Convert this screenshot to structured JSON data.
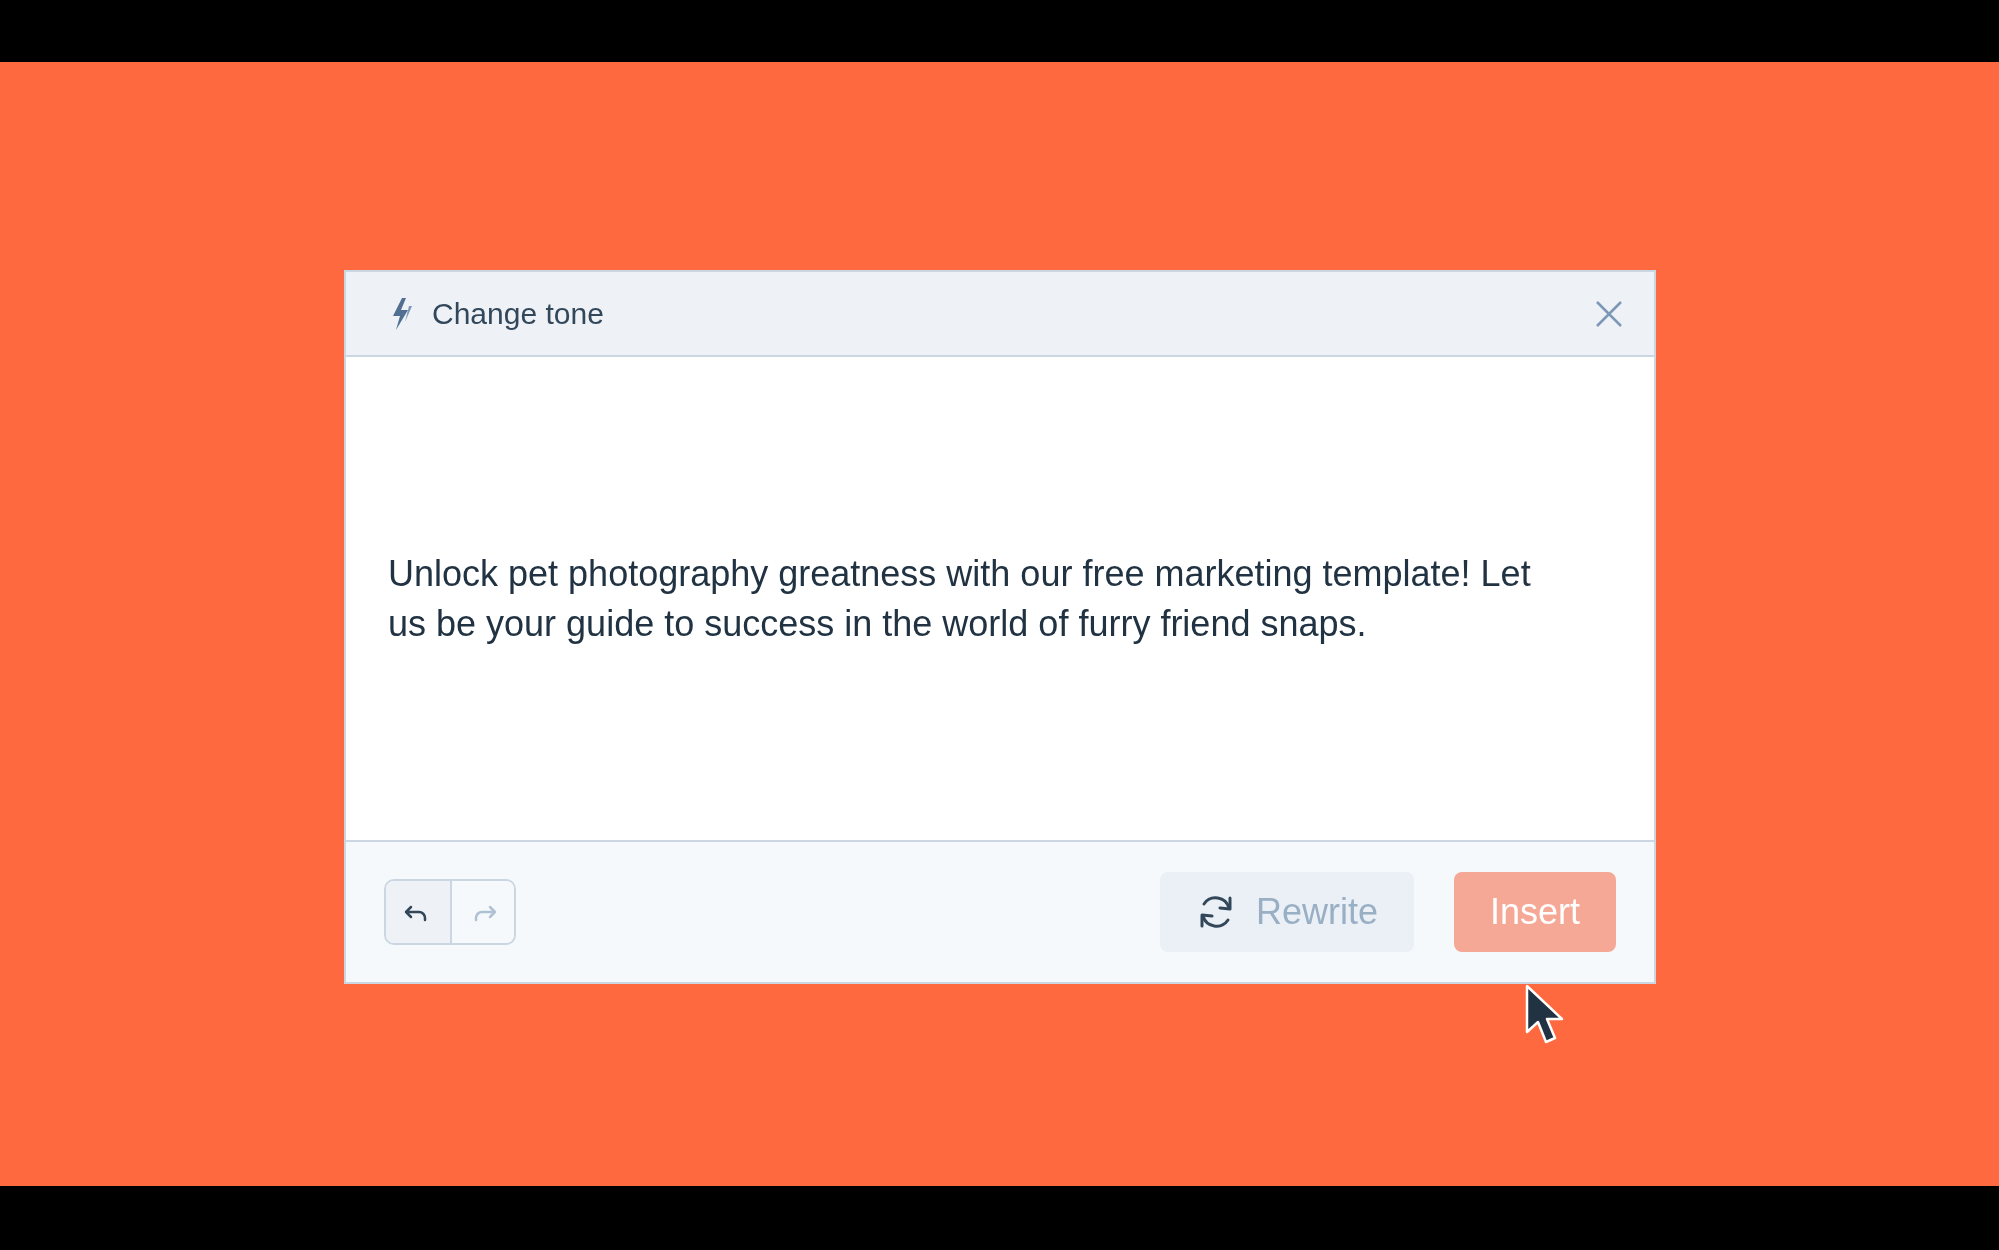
{
  "dialog": {
    "title": "Change tone",
    "text": "Unlock pet photography greatness with our free marketing template! Let us be your guide to success in the world of furry friend snaps.",
    "history": [
      {
        "kind": "undo",
        "disabled": false
      },
      {
        "kind": "redo",
        "disabled": true
      }
    ],
    "buttons": [
      {
        "label": "Rewrite",
        "kind": "secondary",
        "disabled": true
      },
      {
        "label": "Insert",
        "kind": "primary",
        "disabled": true
      }
    ]
  }
}
